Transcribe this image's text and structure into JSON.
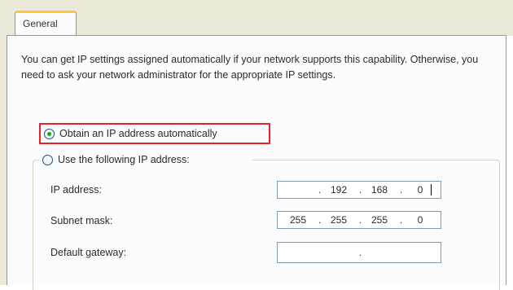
{
  "tab": {
    "label": "General"
  },
  "intro_text": "You can get IP settings assigned automatically if your network supports this capability. Otherwise, you need to ask your network administrator for the appropriate IP settings.",
  "options": {
    "auto_label": "Obtain an IP address automatically",
    "manual_label": "Use the following IP address:",
    "selected": "auto"
  },
  "fields": {
    "ip_address": {
      "label": "IP address:",
      "octets": [
        "",
        "192",
        "168",
        "0"
      ]
    },
    "subnet_mask": {
      "label": "Subnet mask:",
      "octets": [
        "255",
        "255",
        "255",
        "0"
      ]
    },
    "default_gateway": {
      "label": "Default gateway:",
      "octets": [
        "",
        "",
        "",
        ""
      ]
    }
  },
  "highlight_color": "#e8202a",
  "tab_accent_color": "#ffc83c"
}
